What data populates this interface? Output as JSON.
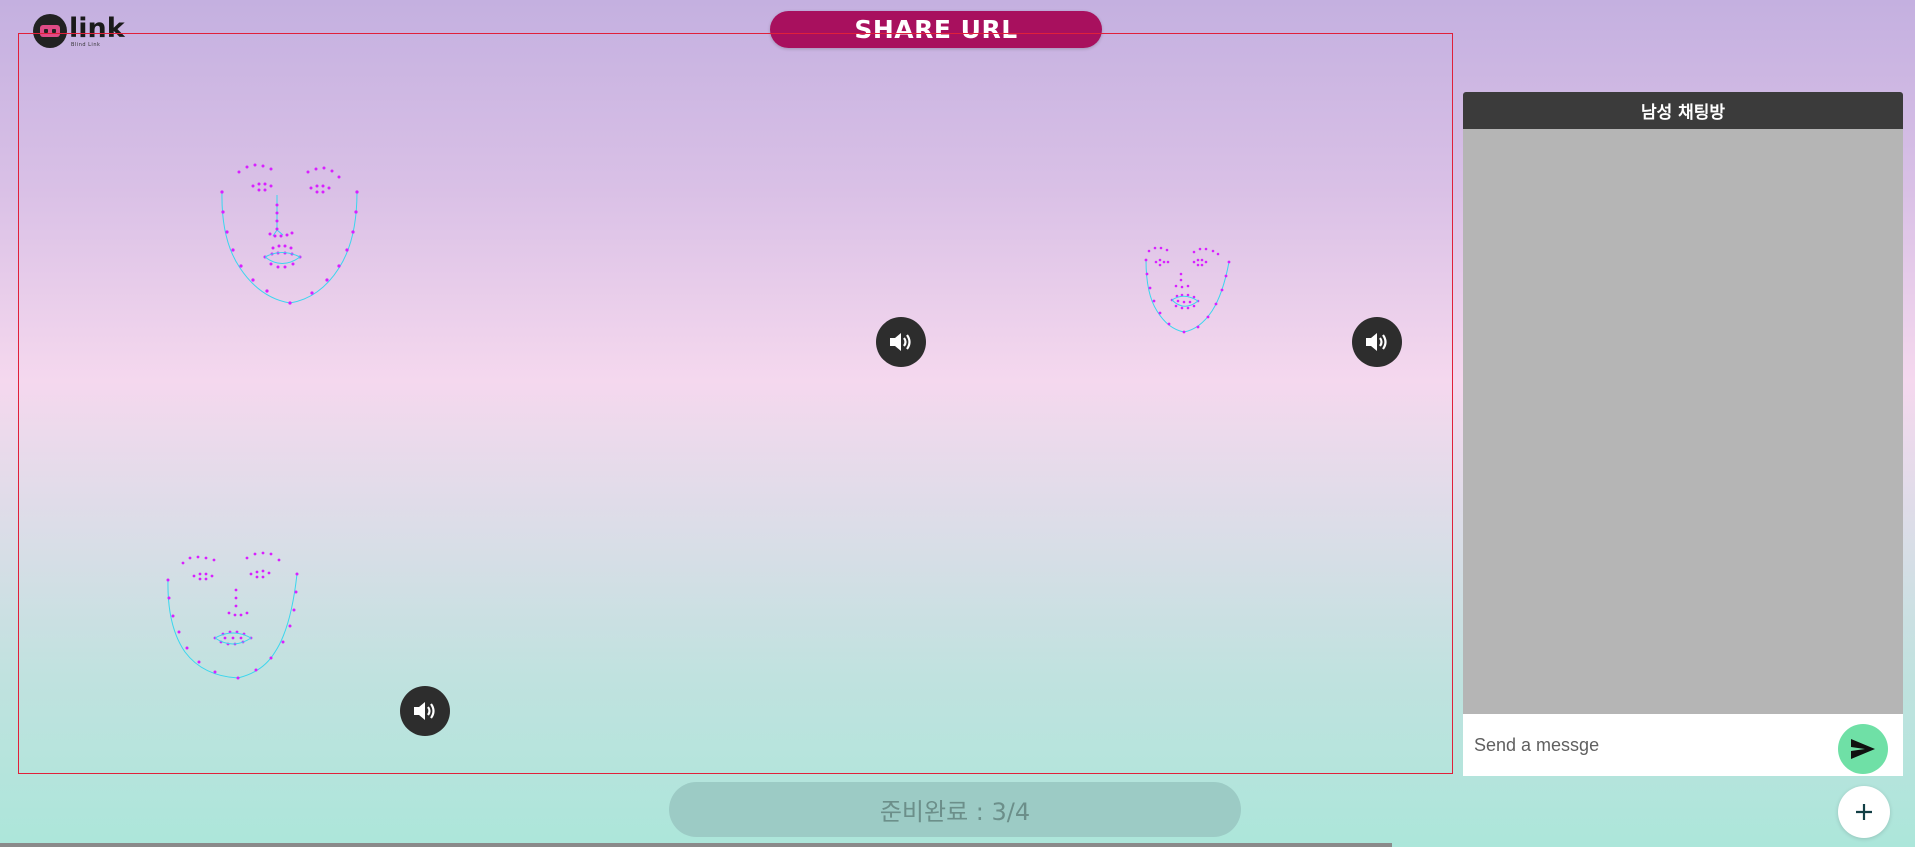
{
  "logo": {
    "word": "link",
    "subtitle": "Blind Link",
    "icon": "mask-logo-icon"
  },
  "header": {
    "share_label": "SHARE URL",
    "accent": "#a8105e"
  },
  "faces": [
    {
      "name": "face-top-left",
      "icon": "face-landmarks-icon"
    },
    {
      "name": "face-top-right",
      "icon": "face-landmarks-icon"
    },
    {
      "name": "face-bottom-left",
      "icon": "face-landmarks-icon"
    }
  ],
  "speakers": [
    {
      "name": "speaker-button-1",
      "icon": "speaker-icon"
    },
    {
      "name": "speaker-button-2",
      "icon": "speaker-icon"
    },
    {
      "name": "speaker-button-3",
      "icon": "speaker-icon"
    }
  ],
  "chat": {
    "title": "남성 채팅방",
    "input_placeholder": "Send a messge",
    "send_icon": "send-icon",
    "send_color": "#6fe0a6"
  },
  "status": {
    "ready_label": "준비완료 : 3/4"
  },
  "actions": {
    "plus_icon": "plus-icon"
  }
}
